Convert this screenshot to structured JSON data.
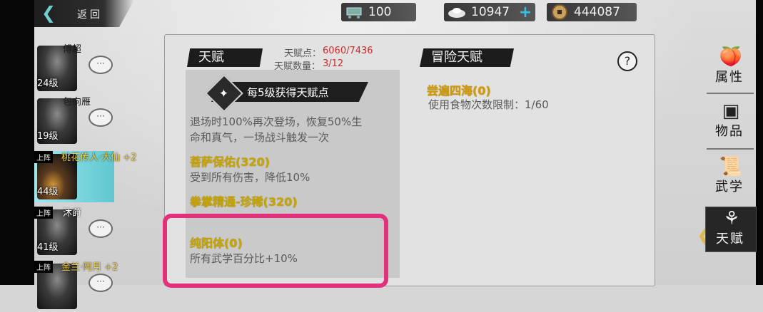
{
  "header": {
    "back_label": "返回",
    "food": "100",
    "silver": "10947",
    "coins": "444087"
  },
  "characters": [
    {
      "name": "傅超",
      "level": "24级",
      "deployed": false
    },
    {
      "name": "包向雁",
      "level": "19级",
      "deployed": false
    },
    {
      "name": "桃花传人·大仙 +2",
      "level": "44级",
      "deployed": true,
      "deploy_label": "上阵"
    },
    {
      "name": "沐莳",
      "level": "41级",
      "deployed": true,
      "deploy_label": "上阵"
    },
    {
      "name": "金兰·阿月 +2",
      "level": "",
      "deployed": true,
      "deploy_label": "上阵"
    }
  ],
  "talent": {
    "title": "天赋",
    "points_label": "天赋点：",
    "points_value": "6060/7436",
    "count_label": "天赋数量：",
    "count_value": "3/12",
    "level_banner": "每5级获得天赋点",
    "first_desc_line1": "退场时100%再次登场，恢复50%生",
    "first_desc_line2": "命和真气，一场战斗触发一次",
    "items": [
      {
        "name": "菩萨保佑(320)",
        "desc": "受到所有伤害，降低10%"
      },
      {
        "name": "拳掌精通-珍稀(320)",
        "desc": ""
      },
      {
        "name": "纯阳体(0)",
        "desc": "所有武学百分比+10%"
      }
    ]
  },
  "adventure": {
    "title": "冒险天赋",
    "items": [
      {
        "name": "尝遍四海(0)",
        "desc": "使用食物次数限制：1/60"
      }
    ]
  },
  "menu": [
    {
      "label": "属性",
      "icon": "peach-icon"
    },
    {
      "label": "物品",
      "icon": "box-icon"
    },
    {
      "label": "武学",
      "icon": "scroll-icon"
    },
    {
      "label": "天赋",
      "icon": "talent-icon",
      "active": true
    }
  ]
}
